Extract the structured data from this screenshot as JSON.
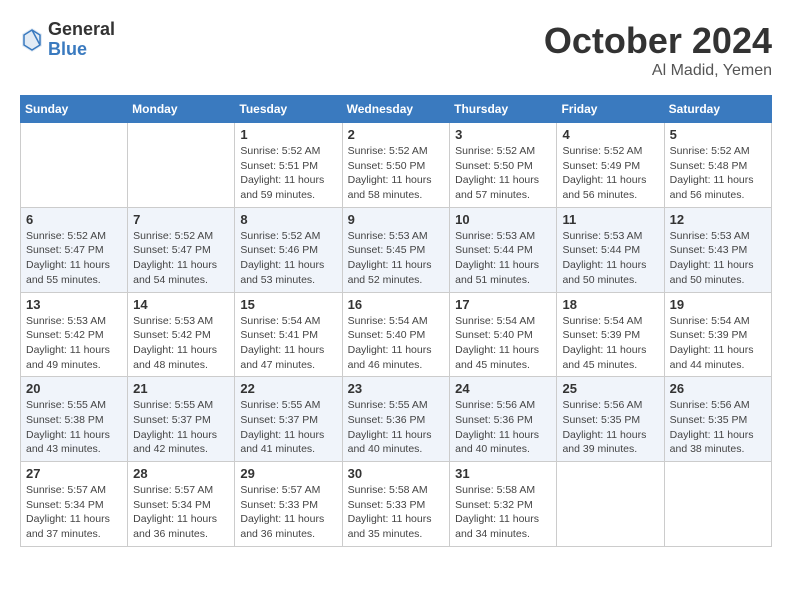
{
  "header": {
    "logo_general": "General",
    "logo_blue": "Blue",
    "month_title": "October 2024",
    "location": "Al Madid, Yemen"
  },
  "weekdays": [
    "Sunday",
    "Monday",
    "Tuesday",
    "Wednesday",
    "Thursday",
    "Friday",
    "Saturday"
  ],
  "weeks": [
    [
      {
        "day": "",
        "info": ""
      },
      {
        "day": "",
        "info": ""
      },
      {
        "day": "1",
        "info": "Sunrise: 5:52 AM\nSunset: 5:51 PM\nDaylight: 11 hours and 59 minutes."
      },
      {
        "day": "2",
        "info": "Sunrise: 5:52 AM\nSunset: 5:50 PM\nDaylight: 11 hours and 58 minutes."
      },
      {
        "day": "3",
        "info": "Sunrise: 5:52 AM\nSunset: 5:50 PM\nDaylight: 11 hours and 57 minutes."
      },
      {
        "day": "4",
        "info": "Sunrise: 5:52 AM\nSunset: 5:49 PM\nDaylight: 11 hours and 56 minutes."
      },
      {
        "day": "5",
        "info": "Sunrise: 5:52 AM\nSunset: 5:48 PM\nDaylight: 11 hours and 56 minutes."
      }
    ],
    [
      {
        "day": "6",
        "info": "Sunrise: 5:52 AM\nSunset: 5:47 PM\nDaylight: 11 hours and 55 minutes."
      },
      {
        "day": "7",
        "info": "Sunrise: 5:52 AM\nSunset: 5:47 PM\nDaylight: 11 hours and 54 minutes."
      },
      {
        "day": "8",
        "info": "Sunrise: 5:52 AM\nSunset: 5:46 PM\nDaylight: 11 hours and 53 minutes."
      },
      {
        "day": "9",
        "info": "Sunrise: 5:53 AM\nSunset: 5:45 PM\nDaylight: 11 hours and 52 minutes."
      },
      {
        "day": "10",
        "info": "Sunrise: 5:53 AM\nSunset: 5:44 PM\nDaylight: 11 hours and 51 minutes."
      },
      {
        "day": "11",
        "info": "Sunrise: 5:53 AM\nSunset: 5:44 PM\nDaylight: 11 hours and 50 minutes."
      },
      {
        "day": "12",
        "info": "Sunrise: 5:53 AM\nSunset: 5:43 PM\nDaylight: 11 hours and 50 minutes."
      }
    ],
    [
      {
        "day": "13",
        "info": "Sunrise: 5:53 AM\nSunset: 5:42 PM\nDaylight: 11 hours and 49 minutes."
      },
      {
        "day": "14",
        "info": "Sunrise: 5:53 AM\nSunset: 5:42 PM\nDaylight: 11 hours and 48 minutes."
      },
      {
        "day": "15",
        "info": "Sunrise: 5:54 AM\nSunset: 5:41 PM\nDaylight: 11 hours and 47 minutes."
      },
      {
        "day": "16",
        "info": "Sunrise: 5:54 AM\nSunset: 5:40 PM\nDaylight: 11 hours and 46 minutes."
      },
      {
        "day": "17",
        "info": "Sunrise: 5:54 AM\nSunset: 5:40 PM\nDaylight: 11 hours and 45 minutes."
      },
      {
        "day": "18",
        "info": "Sunrise: 5:54 AM\nSunset: 5:39 PM\nDaylight: 11 hours and 45 minutes."
      },
      {
        "day": "19",
        "info": "Sunrise: 5:54 AM\nSunset: 5:39 PM\nDaylight: 11 hours and 44 minutes."
      }
    ],
    [
      {
        "day": "20",
        "info": "Sunrise: 5:55 AM\nSunset: 5:38 PM\nDaylight: 11 hours and 43 minutes."
      },
      {
        "day": "21",
        "info": "Sunrise: 5:55 AM\nSunset: 5:37 PM\nDaylight: 11 hours and 42 minutes."
      },
      {
        "day": "22",
        "info": "Sunrise: 5:55 AM\nSunset: 5:37 PM\nDaylight: 11 hours and 41 minutes."
      },
      {
        "day": "23",
        "info": "Sunrise: 5:55 AM\nSunset: 5:36 PM\nDaylight: 11 hours and 40 minutes."
      },
      {
        "day": "24",
        "info": "Sunrise: 5:56 AM\nSunset: 5:36 PM\nDaylight: 11 hours and 40 minutes."
      },
      {
        "day": "25",
        "info": "Sunrise: 5:56 AM\nSunset: 5:35 PM\nDaylight: 11 hours and 39 minutes."
      },
      {
        "day": "26",
        "info": "Sunrise: 5:56 AM\nSunset: 5:35 PM\nDaylight: 11 hours and 38 minutes."
      }
    ],
    [
      {
        "day": "27",
        "info": "Sunrise: 5:57 AM\nSunset: 5:34 PM\nDaylight: 11 hours and 37 minutes."
      },
      {
        "day": "28",
        "info": "Sunrise: 5:57 AM\nSunset: 5:34 PM\nDaylight: 11 hours and 36 minutes."
      },
      {
        "day": "29",
        "info": "Sunrise: 5:57 AM\nSunset: 5:33 PM\nDaylight: 11 hours and 36 minutes."
      },
      {
        "day": "30",
        "info": "Sunrise: 5:58 AM\nSunset: 5:33 PM\nDaylight: 11 hours and 35 minutes."
      },
      {
        "day": "31",
        "info": "Sunrise: 5:58 AM\nSunset: 5:32 PM\nDaylight: 11 hours and 34 minutes."
      },
      {
        "day": "",
        "info": ""
      },
      {
        "day": "",
        "info": ""
      }
    ]
  ]
}
